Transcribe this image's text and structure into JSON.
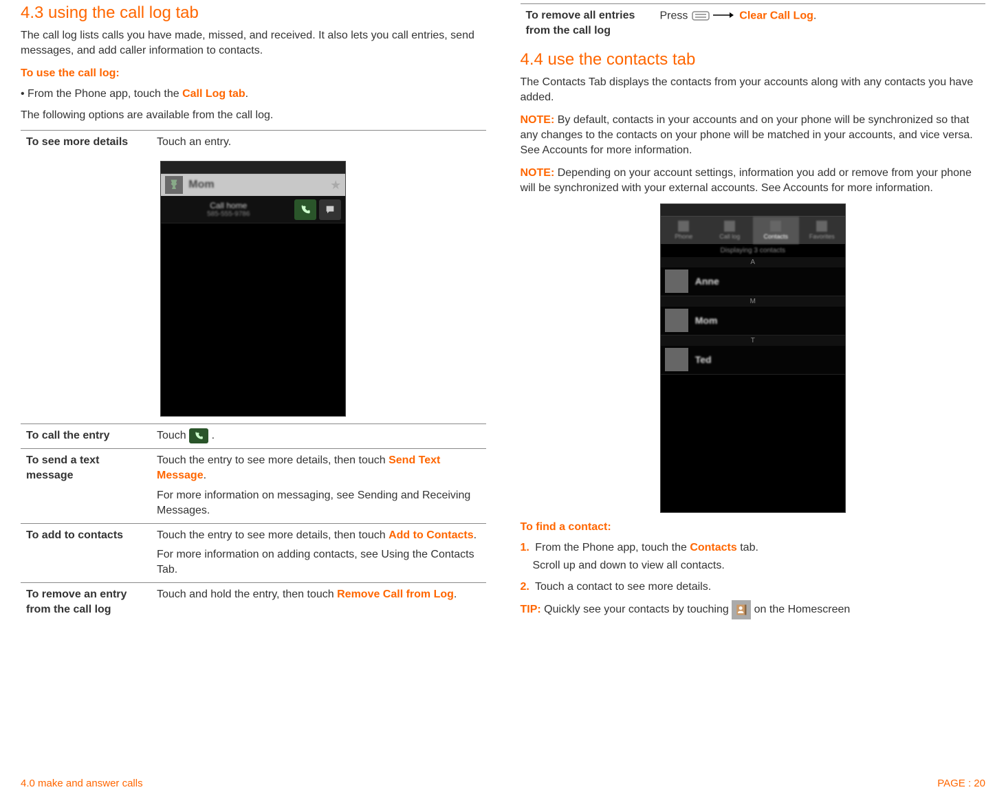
{
  "left": {
    "title": "4.3 using the call log tab",
    "intro": "The call log lists calls you have made, missed, and received. It also lets you call entries, send messages, and add caller information to contacts.",
    "howto_title": "To use the call log:",
    "howto_bullet_prefix": "• From the Phone app, touch the ",
    "howto_bullet_orange": "Call Log tab",
    "howto_bullet_suffix": ".",
    "options_intro": "The following options are available from the call log.",
    "row_seemore_label": "To see more details",
    "row_seemore_value": "Touch an entry.",
    "row_call_label": "To call the entry",
    "row_call_prefix": "Touch ",
    "row_call_suffix": " .",
    "row_text_label": "To send a text message",
    "row_text_line1_a": "Touch the entry to see more details, then touch ",
    "row_text_line1_orange": "Send Text Message",
    "row_text_line1_b": ".",
    "row_text_line2": "For more information on messaging, see Sending and Receiving Messages.",
    "row_add_label": "To add to contacts",
    "row_add_line1_a": "Touch the entry to see more details, then touch ",
    "row_add_line1_orange": "Add to Contacts",
    "row_add_line1_b": ".",
    "row_add_line2": "For more information on adding contacts, see Using the Contacts Tab.",
    "row_remove_label": "To remove an entry from the call log",
    "row_remove_line1_a": "Touch and hold the entry, then touch ",
    "row_remove_line1_orange": "Remove Call from Log",
    "row_remove_line1_b": ".",
    "screenshot": {
      "contact_name": "Mom",
      "call_label": "Call home",
      "phone_number": "585-555-9786"
    }
  },
  "right": {
    "row_removeall_label": "To remove all entries from the call log",
    "row_removeall_a": "Press ",
    "row_removeall_orange": "Clear Call Log",
    "row_removeall_b": ".",
    "title": "4.4 use the contacts tab",
    "intro": "The Contacts Tab displays the contacts from your accounts along with any contacts you have added.",
    "note1_label": "NOTE:",
    "note1_text": " By default, contacts in your accounts and on your phone will be synchronized so that any changes to the contacts on your phone will be matched in your accounts, and vice versa. See Accounts for more information.",
    "note2_label": "NOTE:",
    "note2_text": " Depending on your account settings, information you add or remove from your phone will be synchronized with your external accounts. See Accounts for more information.",
    "find_title": "To find a contact:",
    "step1_a": "From the Phone app, touch the ",
    "step1_orange": "Contacts",
    "step1_b": " tab.",
    "step1_sub": "Scroll up and down to view all contacts.",
    "step2": "Touch a contact to see more details.",
    "tip_label": "TIP:",
    "tip_a": " Quickly see your contacts by touching ",
    "tip_b": " on the Homescreen",
    "screenshot": {
      "tabs": [
        "Phone",
        "Call log",
        "Contacts",
        "Favorites"
      ],
      "hint": "Displaying 3 contacts",
      "alpha": "A",
      "contacts": [
        "Anne",
        "Mom",
        "Ted"
      ]
    }
  },
  "footer": {
    "left": "4.0 make and answer calls",
    "right": "PAGE : 20"
  }
}
